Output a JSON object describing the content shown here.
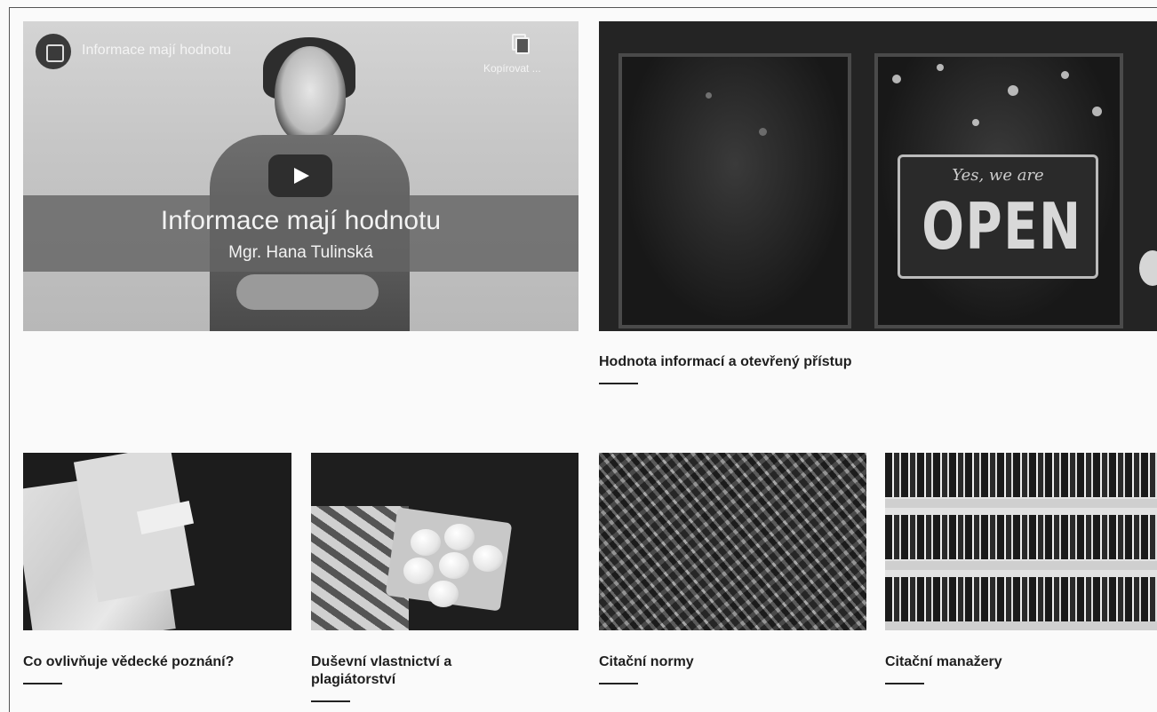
{
  "video": {
    "channel_title": "Informace mají hodnotu",
    "copy_label": "Kopírovat ...",
    "overlay_title": "Informace mají hodnotu",
    "overlay_subtitle": "Mgr. Hana Tulinská"
  },
  "featured": {
    "sign_script": "Yes, we are",
    "sign_word": "OPEN",
    "title": "Hodnota informací a otevřený přístup"
  },
  "cards": [
    {
      "title": "Co ovlivňuje vědecké poznání?"
    },
    {
      "title_line1": "Duševní vlastnictví a",
      "title_line2": "plagiátorství"
    },
    {
      "title": "Citační normy"
    },
    {
      "title": "Citační manažery"
    }
  ]
}
